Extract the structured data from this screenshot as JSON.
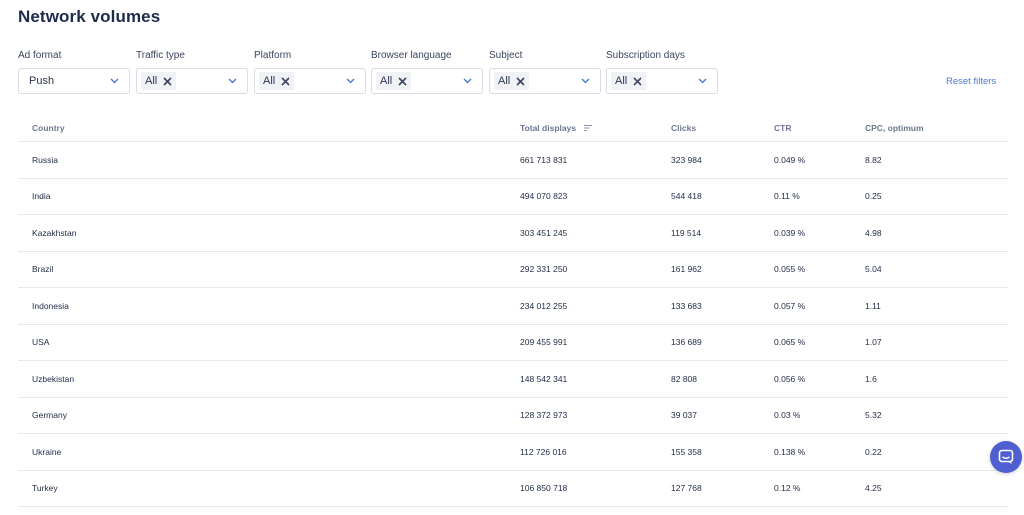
{
  "page_title": "Network volumes",
  "filters": {
    "ad_format": {
      "label": "Ad format",
      "value": "Push"
    },
    "traffic_type": {
      "label": "Traffic type",
      "chip": "All"
    },
    "platform": {
      "label": "Platform",
      "chip": "All"
    },
    "browser_language": {
      "label": "Browser language",
      "chip": "All"
    },
    "subject": {
      "label": "Subject",
      "chip": "All"
    },
    "subscription_days": {
      "label": "Subscription days",
      "chip": "All"
    }
  },
  "reset_filters": "Reset filters",
  "table": {
    "headers": {
      "country": "Country",
      "total_displays": "Total displays",
      "clicks": "Clicks",
      "ctr": "CTR",
      "cpc": "CPC, optimum"
    },
    "rows": [
      {
        "country": "Russia",
        "displays": "661 713 831",
        "clicks": "323 984",
        "ctr": "0.049 %",
        "cpc": "8.82"
      },
      {
        "country": "India",
        "displays": "494 070 823",
        "clicks": "544 418",
        "ctr": "0.11 %",
        "cpc": "0.25"
      },
      {
        "country": "Kazakhstan",
        "displays": "303 451 245",
        "clicks": "119 514",
        "ctr": "0.039 %",
        "cpc": "4.98"
      },
      {
        "country": "Brazil",
        "displays": "292 331 250",
        "clicks": "161 962",
        "ctr": "0.055 %",
        "cpc": "5.04"
      },
      {
        "country": "Indonesia",
        "displays": "234 012 255",
        "clicks": "133 683",
        "ctr": "0.057 %",
        "cpc": "1.11"
      },
      {
        "country": "USA",
        "displays": "209 455 991",
        "clicks": "136 689",
        "ctr": "0.065 %",
        "cpc": "1.07"
      },
      {
        "country": "Uzbekistan",
        "displays": "148 542 341",
        "clicks": "82 808",
        "ctr": "0.056 %",
        "cpc": "1.6"
      },
      {
        "country": "Germany",
        "displays": "128 372 973",
        "clicks": "39 037",
        "ctr": "0.03 %",
        "cpc": "5.32"
      },
      {
        "country": "Ukraine",
        "displays": "112 726 016",
        "clicks": "155 358",
        "ctr": "0.138 %",
        "cpc": "0.22"
      },
      {
        "country": "Turkey",
        "displays": "106 850 718",
        "clicks": "127 768",
        "ctr": "0.12 %",
        "cpc": "4.25"
      }
    ]
  },
  "colors": {
    "accent": "#4a7bd0",
    "chat": "#4f5fd1",
    "title": "#1e2b4a"
  },
  "icons": {
    "dropdown": "chevron-down-icon",
    "remove": "close-icon",
    "sort": "sort-icon",
    "chat": "chat-icon"
  }
}
